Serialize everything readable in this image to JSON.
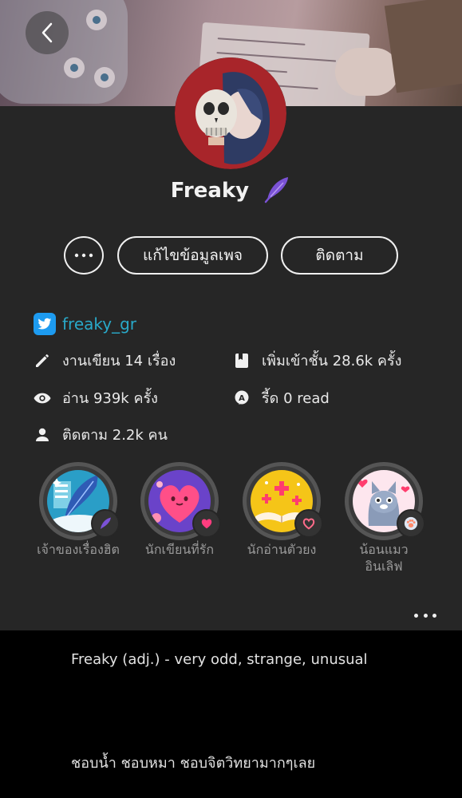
{
  "profile": {
    "name": "Freaky",
    "twitter_handle": "freaky_gr"
  },
  "actions": {
    "more_label": "⋯",
    "edit_label": "แก้ไขข้อมูลเพจ",
    "follow_label": "ติดตาม"
  },
  "stats": {
    "works": "งานเขียน 14 เรื่อง",
    "shelf_adds": "เพิ่มเข้าชั้น 28.6k ครั้ง",
    "reads": "อ่าน 939k ครั้ง",
    "reader": "รี้ด 0 read",
    "followers": "ติดตาม 2.2k คน"
  },
  "badges": [
    {
      "label": "เจ้าของเรื่องฮิต"
    },
    {
      "label": "นักเขียนที่รัก"
    },
    {
      "label": "นักอ่านตัวยง"
    },
    {
      "label": "น้อนแมวอินเลิฟ"
    }
  ],
  "bio": {
    "line1": "Freaky (adj.) - very odd, strange, unusual",
    "line2": "ชอบน้ำ ชอบหมา ชอบจิตวิทยามากๆเลย"
  },
  "colors": {
    "panel": "#262626",
    "twitter": "#1d9bf0",
    "twitter_text": "#29a9c9",
    "feather": "#7b52d6"
  }
}
